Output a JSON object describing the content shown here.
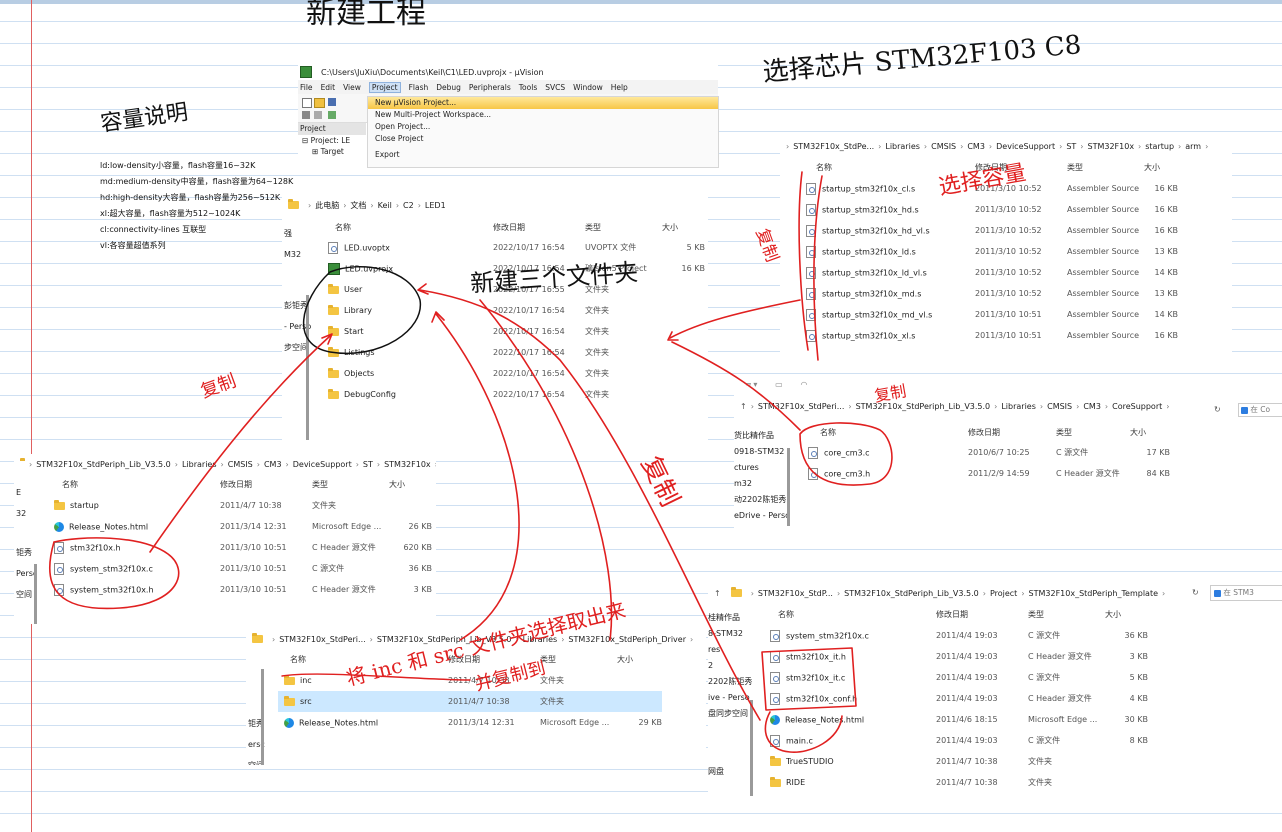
{
  "handwriting": {
    "new_project": "新建工程",
    "capacity_note": "容量说明",
    "select_chip": "选择芯片 STM32F103 C8",
    "new_folders": "新建三个文件夹",
    "select_capacity": "选择容量",
    "copy": "复制",
    "inc_src_note": "将 inc 和 src 文件夹选择取出来",
    "copy_together": "并复制到"
  },
  "capacity_notes": [
    "ld:low-density小容量，flash容量16~32K",
    "md:medium-density中容量，flash容量为64~128K",
    "hd:high-density大容量，flash容量为256~512K",
    "xl:超大容量，flash容量为512~1024K",
    "cl:connectivity-lines 互联型",
    "vl:各容量超值系列"
  ],
  "uvision": {
    "title": "C:\\Users\\JuXiu\\Documents\\Keil\\C1\\LED.uvprojx - µVision",
    "menu": [
      "File",
      "Edit",
      "View",
      "Project",
      "Flash",
      "Debug",
      "Peripherals",
      "Tools",
      "SVCS",
      "Window",
      "Help"
    ],
    "project_tab": "Project",
    "tree": [
      "Project: LE",
      "Target"
    ],
    "dropdown": [
      "New µVision Project...",
      "New Multi-Project Workspace...",
      "Open Project...",
      "Close Project",
      "Export"
    ]
  },
  "explorer_led1": {
    "breadcrumb": [
      "此电脑",
      "文档",
      "Keil",
      "C2",
      "LED1"
    ],
    "headers": [
      "名称",
      "修改日期",
      "类型",
      "大小"
    ],
    "side": [
      "强",
      "M32",
      "彭钜秀",
      "- Perso",
      "步空间"
    ],
    "rows": [
      {
        "name": "LED.uvoptx",
        "date": "2022/10/17 16:54",
        "type": "UVOPTX 文件",
        "size": "5 KB",
        "icon": "file"
      },
      {
        "name": "LED.uvprojx",
        "date": "2022/10/17 16:54",
        "type": "礦ision5 Project",
        "size": "16 KB",
        "icon": "uv"
      },
      {
        "name": "User",
        "date": "2022/10/17 16:55",
        "type": "文件夹",
        "size": "",
        "icon": "folder"
      },
      {
        "name": "Library",
        "date": "2022/10/17 16:54",
        "type": "文件夹",
        "size": "",
        "icon": "folder"
      },
      {
        "name": "Start",
        "date": "2022/10/17 16:54",
        "type": "文件夹",
        "size": "",
        "icon": "folder"
      },
      {
        "name": "Listings",
        "date": "2022/10/17 16:54",
        "type": "文件夹",
        "size": "",
        "icon": "folder"
      },
      {
        "name": "Objects",
        "date": "2022/10/17 16:54",
        "type": "文件夹",
        "size": "",
        "icon": "folder"
      },
      {
        "name": "DebugConfig",
        "date": "2022/10/17 16:54",
        "type": "文件夹",
        "size": "",
        "icon": "folder"
      }
    ]
  },
  "explorer_startup": {
    "breadcrumb": [
      "STM32F10x_StdPe...",
      "Libraries",
      "CMSIS",
      "CM3",
      "DeviceSupport",
      "ST",
      "STM32F10x",
      "startup",
      "arm"
    ],
    "headers": [
      "名称",
      "修改日期",
      "类型",
      "大小"
    ],
    "rows": [
      {
        "name": "startup_stm32f10x_cl.s",
        "date": "2011/3/10 10:52",
        "type": "Assembler Source",
        "size": "16 KB"
      },
      {
        "name": "startup_stm32f10x_hd.s",
        "date": "2011/3/10 10:52",
        "type": "Assembler Source",
        "size": "16 KB"
      },
      {
        "name": "startup_stm32f10x_hd_vl.s",
        "date": "2011/3/10 10:52",
        "type": "Assembler Source",
        "size": "16 KB"
      },
      {
        "name": "startup_stm32f10x_ld.s",
        "date": "2011/3/10 10:52",
        "type": "Assembler Source",
        "size": "13 KB"
      },
      {
        "name": "startup_stm32f10x_ld_vl.s",
        "date": "2011/3/10 10:52",
        "type": "Assembler Source",
        "size": "14 KB"
      },
      {
        "name": "startup_stm32f10x_md.s",
        "date": "2011/3/10 10:52",
        "type": "Assembler Source",
        "size": "13 KB"
      },
      {
        "name": "startup_stm32f10x_md_vl.s",
        "date": "2011/3/10 10:51",
        "type": "Assembler Source",
        "size": "14 KB"
      },
      {
        "name": "startup_stm32f10x_xl.s",
        "date": "2011/3/10 10:51",
        "type": "Assembler Source",
        "size": "16 KB"
      }
    ]
  },
  "explorer_coresupport": {
    "breadcrumb": [
      "STM32F10x_StdPeri...",
      "STM32F10x_StdPeriph_Lib_V3.5.0",
      "Libraries",
      "CMSIS",
      "CM3",
      "CoreSupport"
    ],
    "search": "在 Co",
    "headers": [
      "名称",
      "修改日期",
      "类型",
      "大小"
    ],
    "side": [
      "货比精作品",
      "0918-STM32",
      "ctures",
      "m32",
      "动2202陈钜秀",
      "eDrive - Persc"
    ],
    "rows": [
      {
        "name": "core_cm3.c",
        "date": "2010/6/7 10:25",
        "type": "C 源文件",
        "size": "17 KB"
      },
      {
        "name": "core_cm3.h",
        "date": "2011/2/9 14:59",
        "type": "C Header 源文件",
        "size": "84 KB"
      }
    ]
  },
  "explorer_stm32f10x": {
    "breadcrumb": [
      "STM32F10x_StdPeriph_Lib_V3.5.0",
      "Libraries",
      "CMSIS",
      "CM3",
      "DeviceSupport",
      "ST",
      "STM32F10x"
    ],
    "headers": [
      "名称",
      "修改日期",
      "类型",
      "大小"
    ],
    "side": [
      "E",
      "32",
      "钜秀",
      "Persc",
      "空间"
    ],
    "rows": [
      {
        "name": "startup",
        "date": "2011/4/7 10:38",
        "type": "文件夹",
        "size": "",
        "icon": "folder"
      },
      {
        "name": "Release_Notes.html",
        "date": "2011/3/14 12:31",
        "type": "Microsoft Edge ...",
        "size": "26 KB",
        "icon": "edge"
      },
      {
        "name": "stm32f10x.h",
        "date": "2011/3/10 10:51",
        "type": "C Header 源文件",
        "size": "620 KB",
        "icon": "file"
      },
      {
        "name": "system_stm32f10x.c",
        "date": "2011/3/10 10:51",
        "type": "C 源文件",
        "size": "36 KB",
        "icon": "file"
      },
      {
        "name": "system_stm32f10x.h",
        "date": "2011/3/10 10:51",
        "type": "C Header 源文件",
        "size": "3 KB",
        "icon": "file"
      }
    ]
  },
  "explorer_driver": {
    "breadcrumb": [
      "STM32F10x_StdPeri...",
      "STM32F10x_StdPeriph_Lib_V3.5.0",
      "Libraries",
      "STM32F10x_StdPeriph_Driver"
    ],
    "headers": [
      "名称",
      "修改日期",
      "类型",
      "大小"
    ],
    "side": [
      "钜秀",
      "ersc",
      "空间"
    ],
    "rows": [
      {
        "name": "inc",
        "date": "2011/4/7 10:38",
        "type": "文件夹",
        "size": "",
        "icon": "folder"
      },
      {
        "name": "src",
        "date": "2011/4/7 10:38",
        "type": "文件夹",
        "size": "",
        "icon": "folder",
        "selected": true
      },
      {
        "name": "Release_Notes.html",
        "date": "2011/3/14 12:31",
        "type": "Microsoft Edge ...",
        "size": "29 KB",
        "icon": "edge"
      }
    ]
  },
  "explorer_template": {
    "breadcrumb": [
      "STM32F10x_StdP...",
      "STM32F10x_StdPeriph_Lib_V3.5.0",
      "Project",
      "STM32F10x_StdPeriph_Template"
    ],
    "search": "在 STM3",
    "headers": [
      "名称",
      "修改日期",
      "类型",
      "大小"
    ],
    "side": [
      "桂精作品",
      "8-STM32",
      "res",
      "2",
      "2202陈钜秀",
      "ive - Perso",
      "盘同步空间",
      "网盘"
    ],
    "rows": [
      {
        "name": "system_stm32f10x.c",
        "date": "2011/4/4 19:03",
        "type": "C 源文件",
        "size": "36 KB",
        "icon": "file"
      },
      {
        "name": "stm32f10x_it.h",
        "date": "2011/4/4 19:03",
        "type": "C Header 源文件",
        "size": "3 KB",
        "icon": "file"
      },
      {
        "name": "stm32f10x_it.c",
        "date": "2011/4/4 19:03",
        "type": "C 源文件",
        "size": "5 KB",
        "icon": "file"
      },
      {
        "name": "stm32f10x_conf.h",
        "date": "2011/4/4 19:03",
        "type": "C Header 源文件",
        "size": "4 KB",
        "icon": "file"
      },
      {
        "name": "Release_Notes.html",
        "date": "2011/4/6 18:15",
        "type": "Microsoft Edge ...",
        "size": "30 KB",
        "icon": "edge"
      },
      {
        "name": "main.c",
        "date": "2011/4/4 19:03",
        "type": "C 源文件",
        "size": "8 KB",
        "icon": "file"
      },
      {
        "name": "TrueSTUDIO",
        "date": "2011/4/7 10:38",
        "type": "文件夹",
        "size": "",
        "icon": "folder"
      },
      {
        "name": "RIDE",
        "date": "2011/4/7 10:38",
        "type": "文件夹",
        "size": "",
        "icon": "folder"
      }
    ]
  },
  "colors": {
    "ink": "#e02020",
    "pen": "#111111",
    "selection": "#cce8ff",
    "ruled": "#cfe0f2",
    "margin": "#e06060"
  }
}
